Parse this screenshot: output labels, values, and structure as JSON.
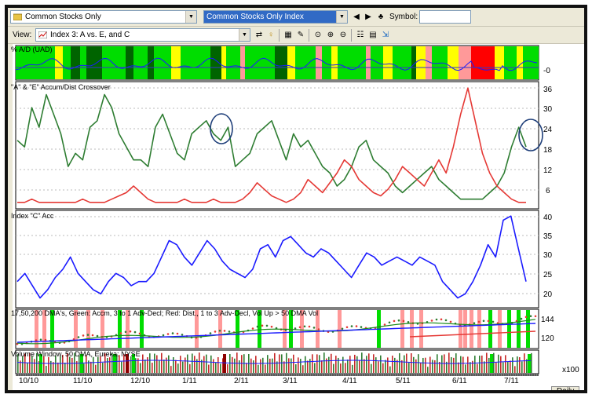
{
  "toolbar": {
    "list_combo": "Common Stocks Only",
    "index_combo": "Common Stocks Only Index",
    "symbol_label": "Symbol:",
    "symbol_value": ""
  },
  "view": {
    "label": "View:",
    "combo": "Index 3: A vs. E, and C"
  },
  "panels": {
    "ad": {
      "title": "% A/D (UAD)",
      "axis": [
        "-0"
      ]
    },
    "ae": {
      "title": "\"A\" & \"E\" Accum/Dist Crossover",
      "axis": [
        "36",
        "30",
        "24",
        "18",
        "12",
        "6"
      ]
    },
    "c": {
      "title": "Index \"C\" Acc",
      "axis": [
        "40",
        "35",
        "30",
        "25",
        "20"
      ]
    },
    "dma": {
      "title": "17,50,200 DMA's, Green:  Accm, 3 to 1 Adv-Decl; Red: Dist., 1 to 3 Adv-Decl, Vol Up > 50 DMA Vol",
      "axis": [
        "144",
        "120"
      ]
    },
    "vol": {
      "title": "Volume Window, 50 DMA, Eureka: NYSE",
      "axis": [
        "x100"
      ]
    }
  },
  "x_labels": [
    "10/10",
    "11/10",
    "12/10",
    "1/11",
    "2/11",
    "3/11",
    "4/11",
    "5/11",
    "6/11",
    "7/11"
  ],
  "period_tab": "Daily",
  "colors": {
    "green": "#2e7d32",
    "red": "#e53935",
    "blue": "#1a1aff",
    "ad_green": "#00dd00",
    "ad_dark": "#006400",
    "ad_yellow": "#ffff00",
    "ad_pink": "#ff9999",
    "ad_red": "#ff0000"
  },
  "chart_data": [
    {
      "type": "line",
      "title": "\"A\" & \"E\" Accum/Dist Crossover",
      "ylim": [
        0,
        37
      ],
      "series": [
        {
          "values": [
            20,
            18,
            30,
            24,
            34,
            28,
            22,
            12,
            16,
            14,
            24,
            26,
            34,
            30,
            22,
            18,
            14,
            14,
            12,
            24,
            28,
            22,
            16,
            14,
            22,
            24,
            26,
            22,
            20,
            24,
            12,
            14,
            16,
            22,
            24,
            26,
            20,
            14,
            22,
            18,
            20,
            16,
            12,
            10,
            6,
            8,
            12,
            18,
            20,
            14,
            12,
            10,
            6,
            4,
            6,
            8,
            10,
            12,
            8,
            6,
            4,
            2,
            2,
            2,
            2,
            4,
            6,
            10,
            18,
            24,
            18
          ]
        },
        {
          "values": [
            1,
            1,
            2,
            1,
            1,
            1,
            1,
            1,
            1,
            2,
            1,
            1,
            1,
            2,
            3,
            4,
            6,
            4,
            2,
            1,
            1,
            1,
            1,
            2,
            1,
            1,
            1,
            2,
            1,
            1,
            1,
            2,
            4,
            7,
            5,
            3,
            2,
            1,
            2,
            4,
            8,
            6,
            4,
            7,
            10,
            14,
            12,
            8,
            6,
            4,
            3,
            5,
            8,
            12,
            10,
            8,
            6,
            10,
            14,
            10,
            18,
            28,
            36,
            26,
            16,
            10,
            6,
            4,
            2,
            1,
            1
          ]
        }
      ]
    },
    {
      "type": "line",
      "title": "Index \"C\" Acc",
      "ylim": [
        18,
        41
      ],
      "series": [
        {
          "values": [
            24,
            26,
            23,
            20,
            22,
            25,
            27,
            30,
            26,
            24,
            22,
            21,
            24,
            26,
            25,
            23,
            24,
            24,
            26,
            30,
            34,
            33,
            30,
            28,
            31,
            34,
            32,
            29,
            27,
            26,
            25,
            27,
            32,
            33,
            30,
            34,
            35,
            33,
            31,
            30,
            32,
            31,
            29,
            27,
            25,
            28,
            31,
            30,
            28,
            29,
            30,
            29,
            28,
            30,
            29,
            28,
            24,
            22,
            20,
            21,
            24,
            28,
            33,
            30,
            39,
            40,
            32,
            24
          ]
        }
      ]
    }
  ]
}
